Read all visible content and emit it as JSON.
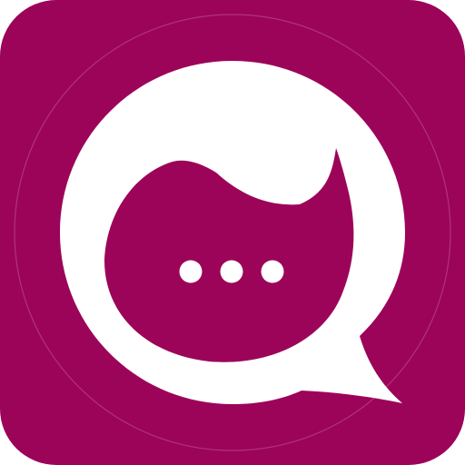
{
  "app_icon": {
    "icon": "chat-bubble-icon",
    "background_color": "#9c0459",
    "bubble_color": "#ffffff",
    "inner_color": "#9c0459",
    "ring_color": "#b5407f",
    "dots_color": "#ffffff",
    "typing_dots": 3
  }
}
